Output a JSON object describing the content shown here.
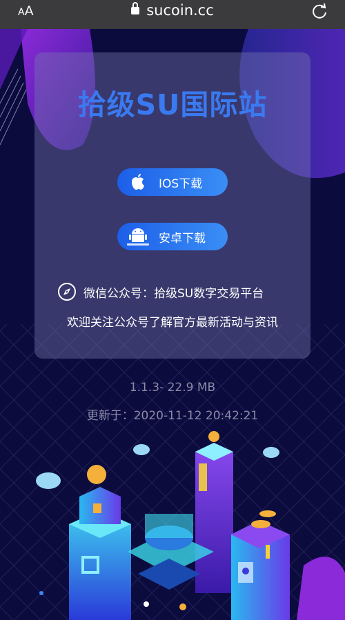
{
  "browser": {
    "text_size_label": "AA",
    "url": "sucoin.cc"
  },
  "card": {
    "title": "拾级SU国际站",
    "ios_button": "IOS下载",
    "android_button": "安卓下载",
    "wechat_text": "微信公众号：拾级SU数字交易平台",
    "follow_text": "欢迎关注公众号了解官方最新活动与资讯"
  },
  "app_info": {
    "version": "1.1.3- 22.9 MB",
    "updated": "更新于：2020-11-12 20:42:21"
  }
}
